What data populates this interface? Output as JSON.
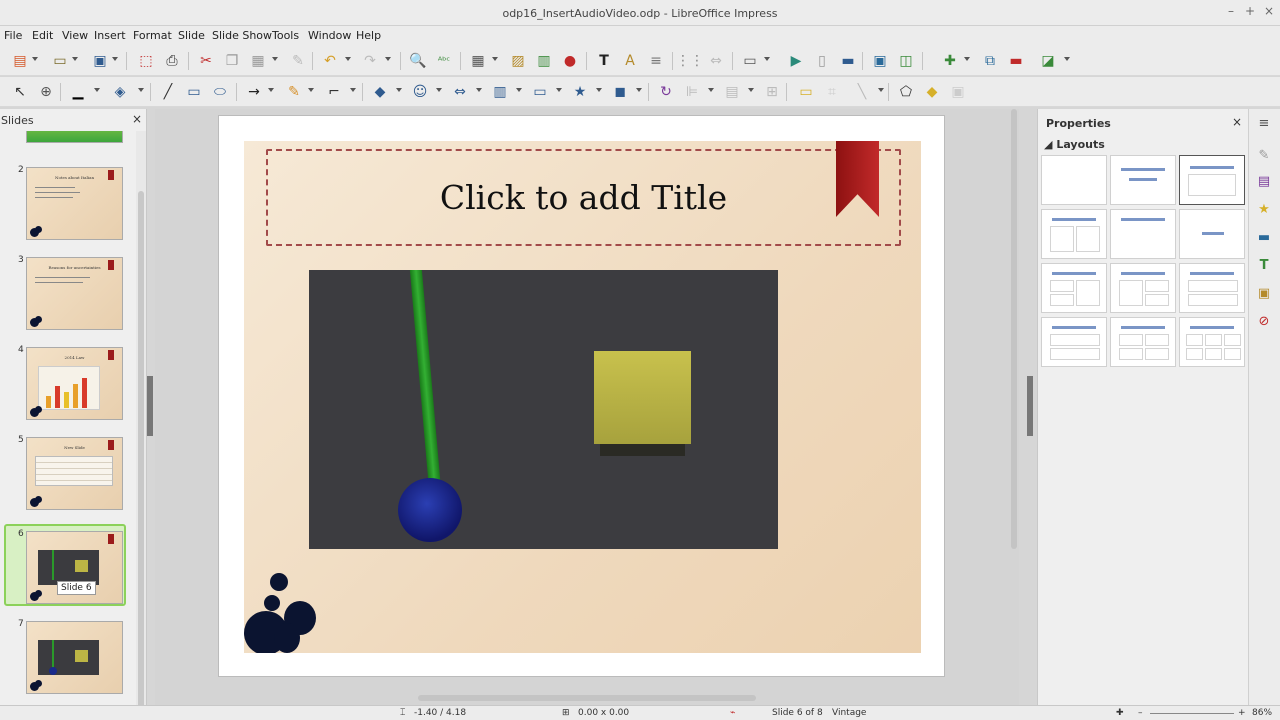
{
  "window": {
    "title": "odp16_InsertAudioVideo.odp - LibreOffice Impress"
  },
  "menu": [
    "File",
    "Edit",
    "View",
    "Insert",
    "Format",
    "Slide",
    "Slide Show",
    "Tools",
    "Window",
    "Help"
  ],
  "slides_pane": {
    "label": "Slides",
    "close": "×",
    "thumbnails": [
      {
        "number": "2",
        "title": "Notes about Italian",
        "bullets": [
          "We will be there",
          "Welcome to the Italian site",
          "Photograph should regards"
        ]
      },
      {
        "number": "3",
        "title": "Reasons for uncertainties",
        "bullets": [
          "Several questions to be resolved today",
          "Help is required when interested"
        ]
      },
      {
        "number": "4",
        "title": "2014 Law",
        "chart": true
      },
      {
        "number": "5",
        "title": "New Slide",
        "table": true
      },
      {
        "number": "6",
        "active": true
      },
      {
        "number": "7"
      }
    ],
    "tooltip": "Slide 6"
  },
  "slide": {
    "title_placeholder": "Click to add Title"
  },
  "sidebar": {
    "title": "Properties",
    "close": "×",
    "section": "Layouts",
    "section_arrow": "◢"
  },
  "statusbar": {
    "position": "-1.40 / 4.18",
    "size": "0.00 x 0.00",
    "slide_info": "Slide 6 of 8",
    "master": "Vintage",
    "zoom": "86%"
  },
  "colors": {
    "ribbon": "#9b1b1b",
    "active_thumb_border": "#8cd15a",
    "layout_title_line": "#7a95c6"
  }
}
